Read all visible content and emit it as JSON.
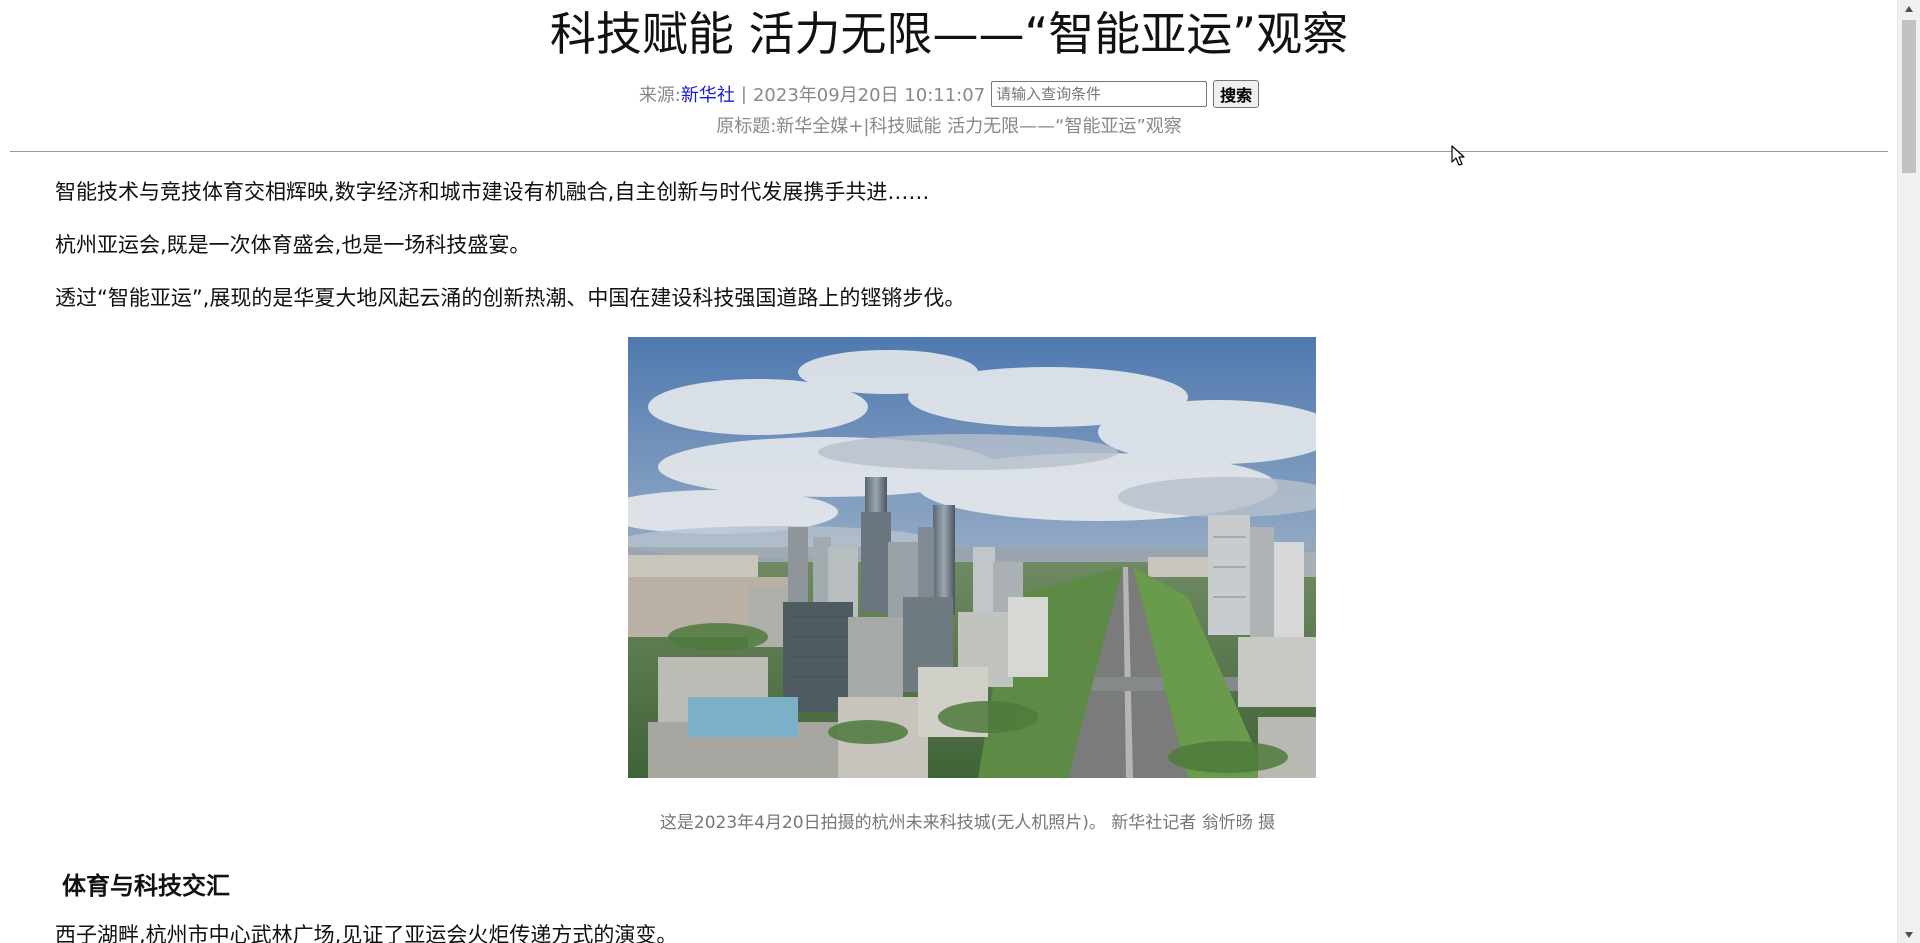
{
  "article": {
    "title": "科技赋能 活力无限——“智能亚运”观察",
    "source_label": "来源:",
    "source_name": "新华社",
    "separator": "|",
    "datetime": "2023年09月20日 10:11:07",
    "original_title": "原标题:新华全媒+|科技赋能 活力无限——“智能亚运”观察",
    "paragraphs": [
      "智能技术与竞技体育交相辉映,数字经济和城市建设有机融合,自主创新与时代发展携手共进……",
      "杭州亚运会,既是一次体育盛会,也是一场科技盛宴。",
      "透过“智能亚运”,展现的是华夏大地风起云涌的创新热潮、中国在建设科技强国道路上的铿锵步伐。"
    ],
    "image_caption": "这是2023年4月20日拍摄的杭州未来科技城(无人机照片)。 新华社记者 翁忻旸 摄",
    "section_heading": "体育与科技交汇",
    "next_paragraph": "西子湖畔,杭州市中心武林广场,见证了亚运会火炬传递方式的演变。"
  },
  "search": {
    "placeholder": "请输入查询条件",
    "button_label": "搜索"
  },
  "colors": {
    "link": "#1a1adb",
    "meta_text": "#888888",
    "body_text": "#111111"
  },
  "icons": {
    "cursor": "mouse-pointer-icon",
    "scroll_up": "chevron-up-icon",
    "scroll_down": "chevron-down-icon"
  }
}
